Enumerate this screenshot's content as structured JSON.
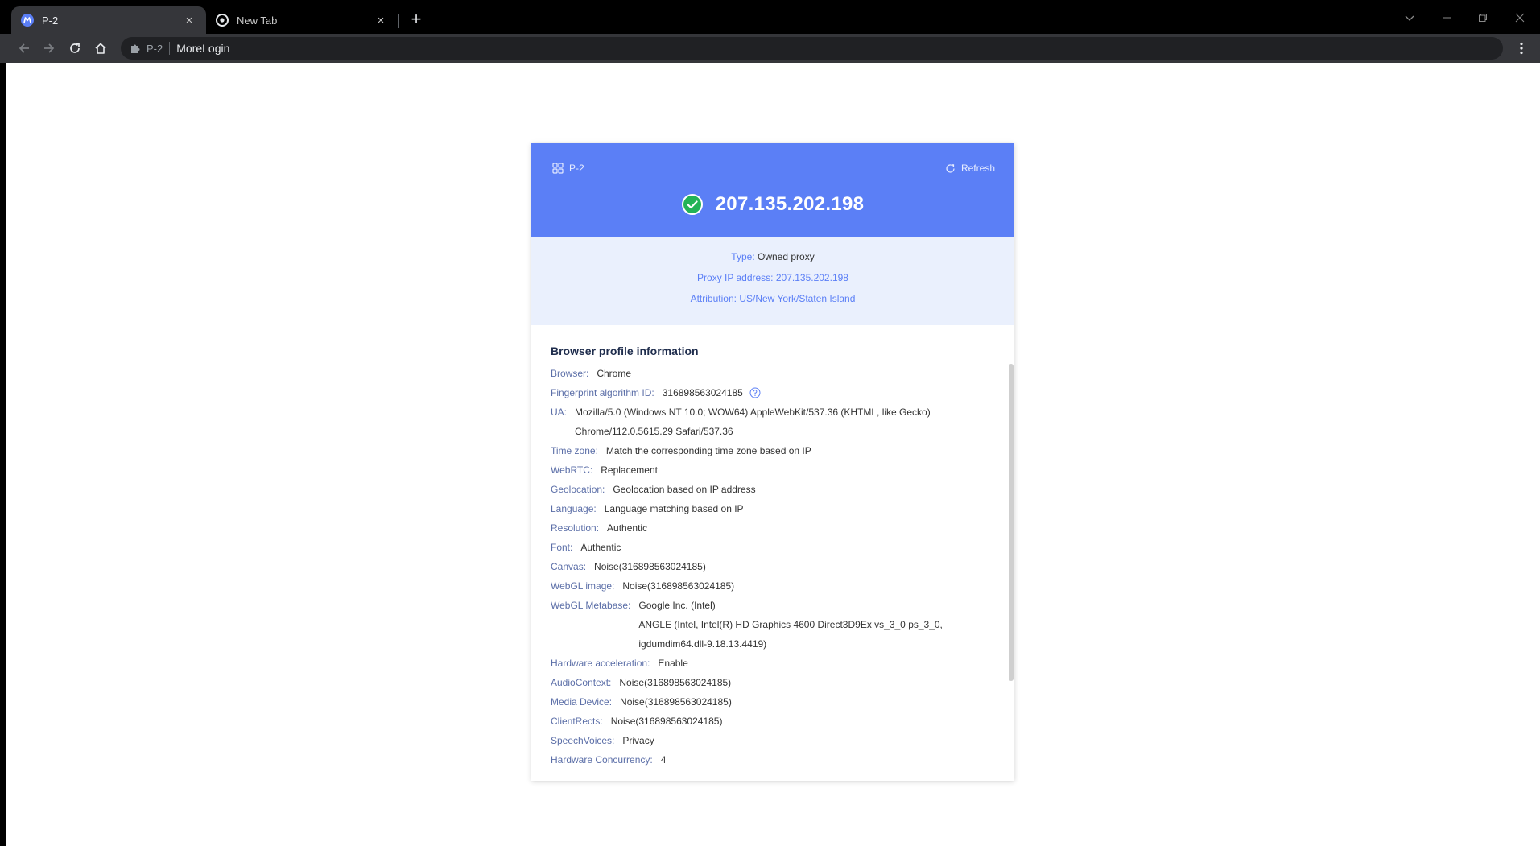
{
  "browser": {
    "tabs": [
      {
        "title": "P-2",
        "favicon": "morelogin-logo-icon",
        "active": true
      },
      {
        "title": "New Tab",
        "favicon": "chrome-logo-icon",
        "active": false
      }
    ],
    "new_tab": "+",
    "close_glyph": "×",
    "omnibox": {
      "extension_label": "P-2",
      "url": "MoreLogin"
    }
  },
  "header": {
    "profile": "P-2",
    "refresh": "Refresh",
    "ip": "207.135.202.198",
    "status": "connected",
    "accent": "#5b7ff6"
  },
  "proxy": {
    "type_label": "Type:",
    "type_value": "Owned proxy",
    "ip_label": "Proxy IP address:",
    "ip_value": "207.135.202.198",
    "attr_label": "Attribution:",
    "attr_value": "US/New York/Staten Island"
  },
  "profile_info": {
    "title": "Browser profile information",
    "rows": [
      {
        "key": "Browser:",
        "value": "Chrome"
      },
      {
        "key": "Fingerprint algorithm ID:",
        "value": "316898563024185"
      },
      {
        "key": "UA:",
        "value": "Mozilla/5.0 (Windows NT 10.0; WOW64) AppleWebKit/537.36 (KHTML, like Gecko)",
        "value2": "Chrome/112.0.5615.29 Safari/537.36"
      },
      {
        "key": "Time zone:",
        "value": "Match the corresponding time zone based on IP"
      },
      {
        "key": "WebRTC:",
        "value": "Replacement"
      },
      {
        "key": "Geolocation:",
        "value": "Geolocation based on IP address"
      },
      {
        "key": "Language:",
        "value": "Language matching based on IP"
      },
      {
        "key": "Resolution:",
        "value": "Authentic"
      },
      {
        "key": "Font:",
        "value": "Authentic"
      },
      {
        "key": "Canvas:",
        "value": "Noise(316898563024185)"
      },
      {
        "key": "WebGL image:",
        "value": "Noise(316898563024185)"
      },
      {
        "key": "WebGL Metabase:",
        "value": "Google Inc. (Intel)",
        "value2": "ANGLE (Intel, Intel(R) HD Graphics 4600 Direct3D9Ex vs_3_0 ps_3_0,",
        "value3": "igdumdim64.dll-9.18.13.4419)"
      },
      {
        "key": "Hardware acceleration:",
        "value": "Enable"
      },
      {
        "key": "AudioContext:",
        "value": "Noise(316898563024185)"
      },
      {
        "key": "Media Device:",
        "value": "Noise(316898563024185)"
      },
      {
        "key": "ClientRects:",
        "value": "Noise(316898563024185)"
      },
      {
        "key": "SpeechVoices:",
        "value": "Privacy"
      },
      {
        "key": "Hardware Concurrency:",
        "value": "4"
      }
    ]
  }
}
